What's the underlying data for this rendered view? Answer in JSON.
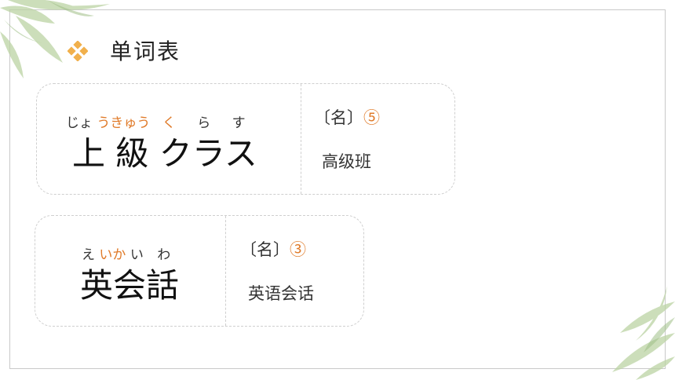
{
  "header": {
    "title": "单词表"
  },
  "colors": {
    "accent": "#e07b2a",
    "icon": "#f1b04c",
    "border": "#cfcfcf"
  },
  "cards": [
    {
      "ruby": [
        {
          "text": "じょ",
          "highlight": false
        },
        {
          "text": "うきゅう",
          "highlight": true
        },
        {
          "text": "く",
          "highlight": true
        },
        {
          "text": "ら",
          "highlight": false
        },
        {
          "text": "す",
          "highlight": false
        }
      ],
      "word": "上 級 クラス",
      "pos_open": "〔名〕",
      "accent_num": "⑤",
      "meaning": "高级班"
    },
    {
      "ruby": [
        {
          "text": "え",
          "highlight": false
        },
        {
          "text": "いか",
          "highlight": true
        },
        {
          "text": "い",
          "highlight": false
        },
        {
          "text": "わ",
          "highlight": false
        }
      ],
      "word": "英会話",
      "pos_open": "〔名〕",
      "accent_num": "③",
      "meaning": "英语会话"
    }
  ]
}
